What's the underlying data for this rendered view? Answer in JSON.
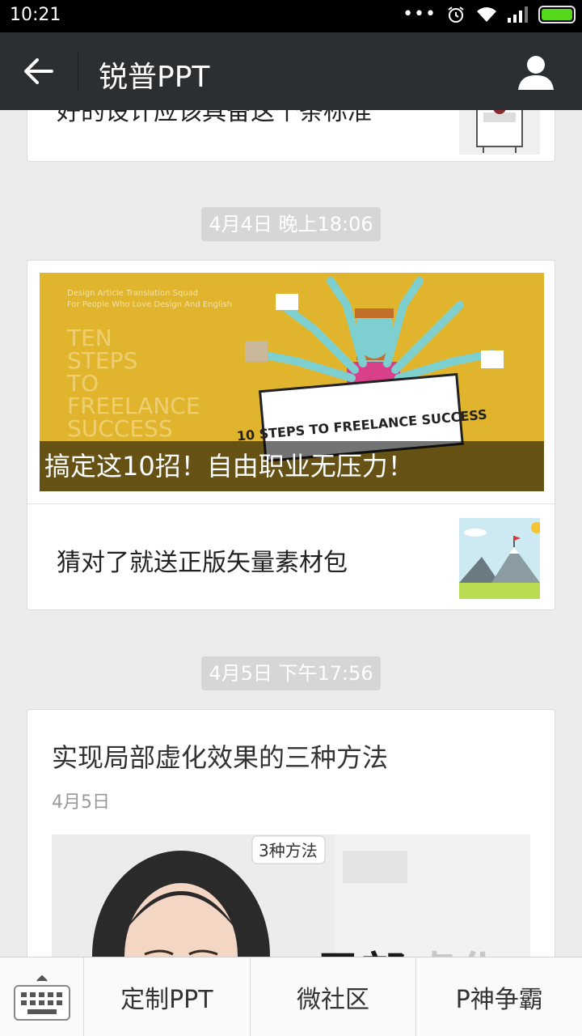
{
  "status_bar": {
    "time": "10:21"
  },
  "header": {
    "title": "锐普PPT"
  },
  "feed": {
    "card1": {
      "text": "好的设计应该具备这个条标准"
    },
    "timestamp1": "4月4日 晚上18:06",
    "card2": {
      "banner_caption": "搞定这10招！自由职业无压力！",
      "banner_sign_text": "10 STEPS TO FREELANCE SUCCESS",
      "banner_overlay_text": "TEN STEPS TO FREELANCE SUCCESS",
      "banner_small_text_1": "Design Article Translation Squad",
      "banner_small_text_2": "For People Who Love Design And English",
      "row_text": "猜对了就送正版矢量素材包"
    },
    "timestamp2": "4月5日 下午17:56",
    "card3": {
      "title": "实现局部虚化效果的三种方法",
      "date": "4月5日",
      "image_tag": "3种方法",
      "image_text_1": "局部",
      "image_text_2": "虚化"
    }
  },
  "bottom_menu": {
    "items": [
      "定制PPT",
      "微社区",
      "P神争霸"
    ]
  },
  "colors": {
    "header_bg": "#2c2f31",
    "battery": "#56d91b",
    "banner_bg": "#e0b52d"
  }
}
